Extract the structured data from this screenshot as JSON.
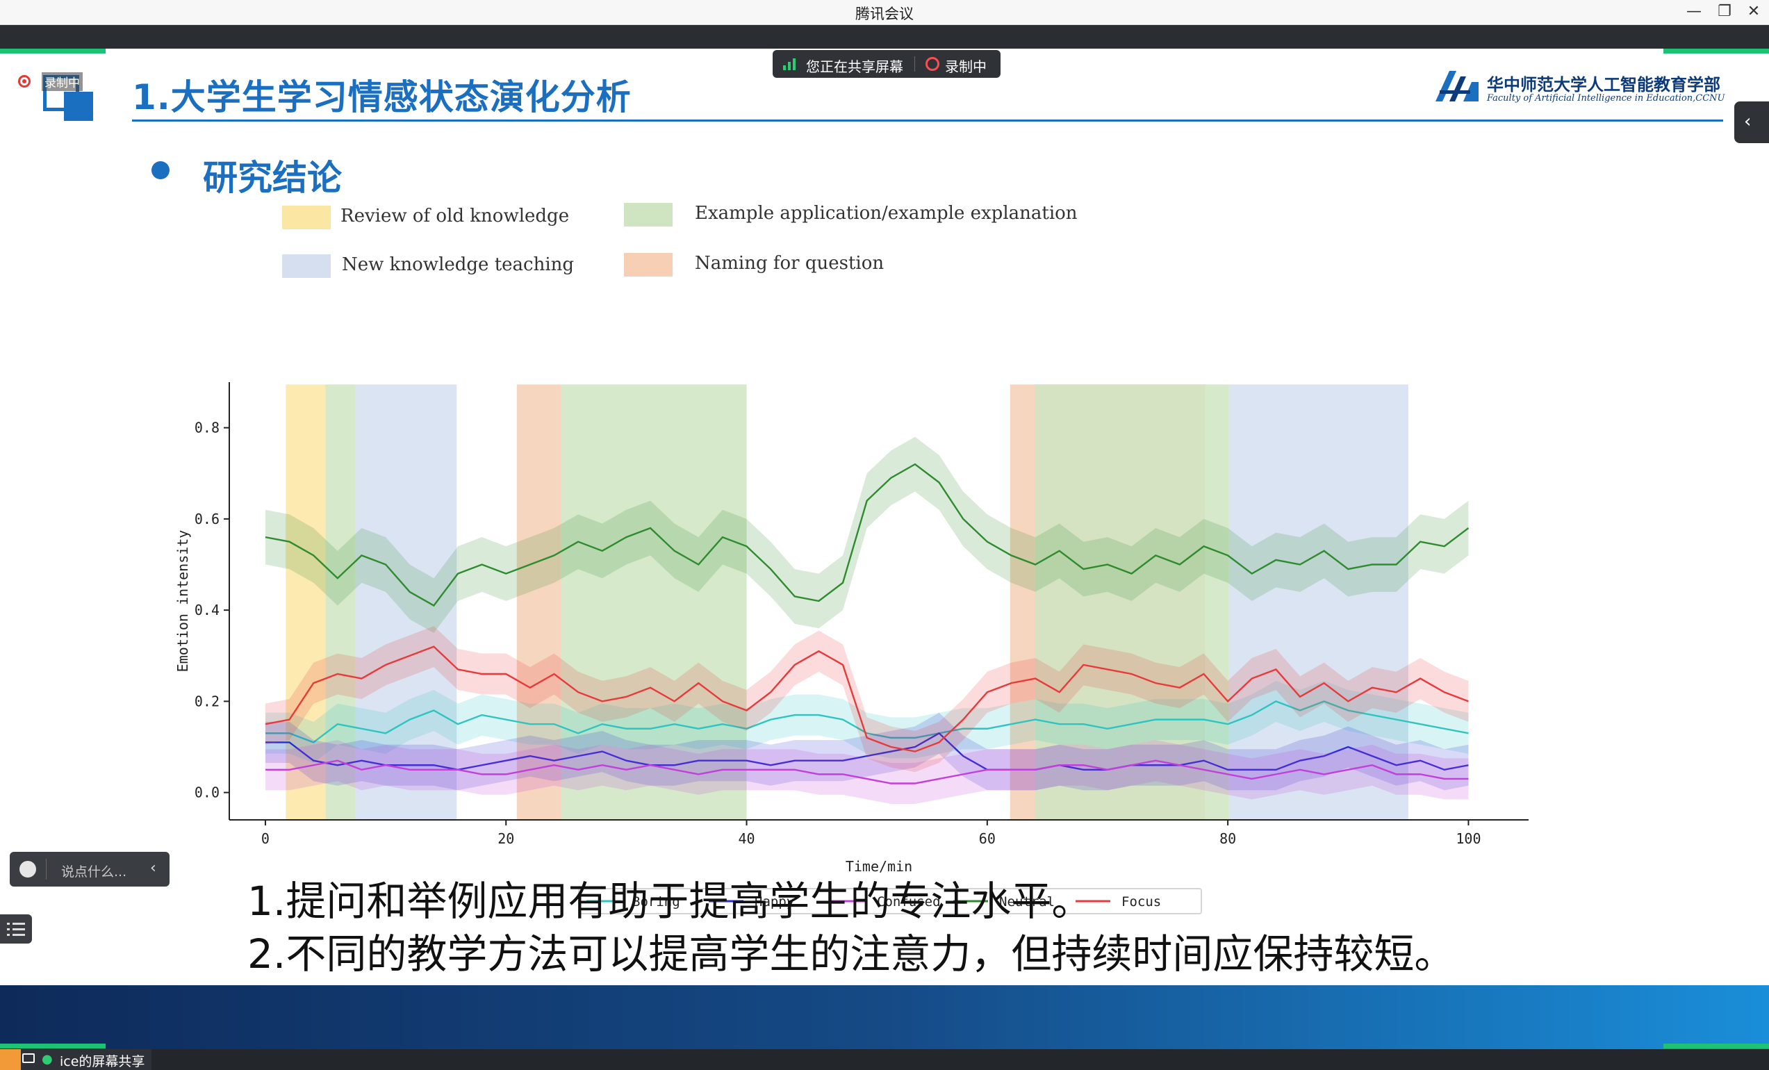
{
  "window": {
    "title": "腾讯会议",
    "minimize_glyph": "—",
    "restore_glyph": "❐",
    "close_glyph": "✕"
  },
  "sharing": {
    "status": "您正在共享屏幕",
    "recording": "录制中",
    "mini_recording_label": "录制中"
  },
  "slide": {
    "title": "1.大学生学习情感状态演化分析",
    "university_name": "华中师范大学人工智能教育学部",
    "university_en": "Faculty of Artificial Intelligence in Education,CCNU",
    "section_heading": "研究结论",
    "phase_legend": [
      {
        "label": "Review of old knowledge",
        "color": "#fbe6a3"
      },
      {
        "label": "Example application/example explanation",
        "color": "#cfe5c2"
      },
      {
        "label": "New knowledge teaching",
        "color": "#d5dff0"
      },
      {
        "label": "Naming for question",
        "color": "#f6cfb4"
      }
    ],
    "conclusions": [
      "1.提问和举例应用有助于提高学生的专注水平。",
      "2.不同的教学方法可以提高学生的注意力，但持续时间应保持较短。"
    ]
  },
  "chart_data": {
    "type": "line",
    "title": "",
    "xlabel": "Time/min",
    "ylabel": "Emotion intensity",
    "xlim": [
      -3,
      105
    ],
    "ylim": [
      -0.06,
      0.9
    ],
    "xticks": [
      0,
      20,
      40,
      60,
      80,
      100
    ],
    "yticks": [
      0.0,
      0.2,
      0.4,
      0.6,
      0.8
    ],
    "xtick_labels": [
      "0",
      "20",
      "40",
      "60",
      "80",
      "100"
    ],
    "ytick_labels": [
      "0.0",
      "0.2",
      "0.4",
      "0.6",
      "0.8"
    ],
    "legend_position": "bottom-center",
    "phase_bands": [
      {
        "phase": "Review of old knowledge",
        "start": 1.7,
        "end": 5,
        "color": "#fbe6a3"
      },
      {
        "phase": "Example application/example explanation",
        "start": 5,
        "end": 7.5,
        "color": "#cfe5c2"
      },
      {
        "phase": "New knowledge teaching",
        "start": 7.5,
        "end": 15.9,
        "color": "#d5dff0"
      },
      {
        "phase": "Naming for question",
        "start": 20.9,
        "end": 24.6,
        "color": "#f6cfb4"
      },
      {
        "phase": "Example application/example explanation",
        "start": 24.6,
        "end": 40,
        "color": "#cfe5c2"
      },
      {
        "phase": "Naming for question",
        "start": 61.9,
        "end": 78.1,
        "color": "#f6cfb4"
      },
      {
        "phase": "Example application/example explanation",
        "start": 64,
        "end": 80.1,
        "color": "#cfe5c2"
      },
      {
        "phase": "New knowledge teaching",
        "start": 80.1,
        "end": 95,
        "color": "#d5dff0"
      }
    ],
    "x": [
      0,
      2,
      4,
      6,
      8,
      10,
      12,
      14,
      16,
      18,
      20,
      22,
      24,
      26,
      28,
      30,
      32,
      34,
      36,
      38,
      40,
      42,
      44,
      46,
      48,
      50,
      52,
      54,
      56,
      58,
      60,
      62,
      64,
      66,
      68,
      70,
      72,
      74,
      76,
      78,
      80,
      82,
      84,
      86,
      88,
      90,
      92,
      94,
      96,
      98,
      100
    ],
    "series": [
      {
        "name": "Boring",
        "color": "#2ec4c0",
        "values": [
          0.13,
          0.13,
          0.11,
          0.15,
          0.14,
          0.13,
          0.16,
          0.18,
          0.15,
          0.17,
          0.16,
          0.15,
          0.15,
          0.13,
          0.15,
          0.14,
          0.14,
          0.15,
          0.14,
          0.15,
          0.14,
          0.16,
          0.17,
          0.17,
          0.16,
          0.13,
          0.12,
          0.12,
          0.13,
          0.14,
          0.14,
          0.15,
          0.16,
          0.15,
          0.15,
          0.14,
          0.15,
          0.16,
          0.16,
          0.16,
          0.15,
          0.17,
          0.2,
          0.18,
          0.2,
          0.18,
          0.17,
          0.16,
          0.15,
          0.14,
          0.13
        ]
      },
      {
        "name": "Happy",
        "color": "#2b2bd6",
        "values": [
          0.11,
          0.11,
          0.07,
          0.06,
          0.07,
          0.06,
          0.06,
          0.06,
          0.05,
          0.06,
          0.07,
          0.08,
          0.07,
          0.08,
          0.09,
          0.07,
          0.06,
          0.06,
          0.07,
          0.07,
          0.07,
          0.06,
          0.07,
          0.07,
          0.07,
          0.08,
          0.09,
          0.1,
          0.13,
          0.08,
          0.05,
          0.05,
          0.05,
          0.06,
          0.05,
          0.05,
          0.06,
          0.06,
          0.06,
          0.07,
          0.05,
          0.05,
          0.05,
          0.07,
          0.08,
          0.1,
          0.08,
          0.06,
          0.07,
          0.05,
          0.06
        ]
      },
      {
        "name": "Confused",
        "color": "#c23fd9",
        "values": [
          0.05,
          0.05,
          0.06,
          0.07,
          0.05,
          0.06,
          0.05,
          0.05,
          0.05,
          0.04,
          0.04,
          0.05,
          0.06,
          0.05,
          0.06,
          0.05,
          0.06,
          0.05,
          0.04,
          0.05,
          0.05,
          0.05,
          0.05,
          0.04,
          0.04,
          0.03,
          0.02,
          0.02,
          0.03,
          0.04,
          0.05,
          0.05,
          0.05,
          0.06,
          0.06,
          0.05,
          0.06,
          0.07,
          0.06,
          0.05,
          0.04,
          0.03,
          0.04,
          0.05,
          0.04,
          0.05,
          0.06,
          0.04,
          0.04,
          0.03,
          0.03
        ]
      },
      {
        "name": "Neutral",
        "color": "#2e8b2e",
        "values": [
          0.56,
          0.55,
          0.52,
          0.47,
          0.52,
          0.5,
          0.44,
          0.41,
          0.48,
          0.5,
          0.48,
          0.5,
          0.52,
          0.55,
          0.53,
          0.56,
          0.58,
          0.53,
          0.5,
          0.56,
          0.54,
          0.49,
          0.43,
          0.42,
          0.46,
          0.64,
          0.69,
          0.72,
          0.68,
          0.6,
          0.55,
          0.52,
          0.5,
          0.53,
          0.49,
          0.5,
          0.48,
          0.52,
          0.5,
          0.54,
          0.52,
          0.48,
          0.51,
          0.5,
          0.53,
          0.49,
          0.5,
          0.5,
          0.55,
          0.54,
          0.58
        ]
      },
      {
        "name": "Focus",
        "color": "#e83a3a",
        "values": [
          0.15,
          0.16,
          0.24,
          0.26,
          0.25,
          0.28,
          0.3,
          0.32,
          0.27,
          0.26,
          0.26,
          0.23,
          0.26,
          0.22,
          0.2,
          0.21,
          0.23,
          0.2,
          0.24,
          0.2,
          0.18,
          0.22,
          0.28,
          0.31,
          0.28,
          0.12,
          0.1,
          0.09,
          0.11,
          0.16,
          0.22,
          0.24,
          0.25,
          0.22,
          0.28,
          0.27,
          0.26,
          0.24,
          0.23,
          0.26,
          0.2,
          0.25,
          0.27,
          0.21,
          0.24,
          0.2,
          0.23,
          0.22,
          0.25,
          0.22,
          0.2
        ]
      }
    ]
  },
  "chat": {
    "placeholder": "说点什么..."
  },
  "presenter": {
    "label": "ice的屏幕共享"
  }
}
